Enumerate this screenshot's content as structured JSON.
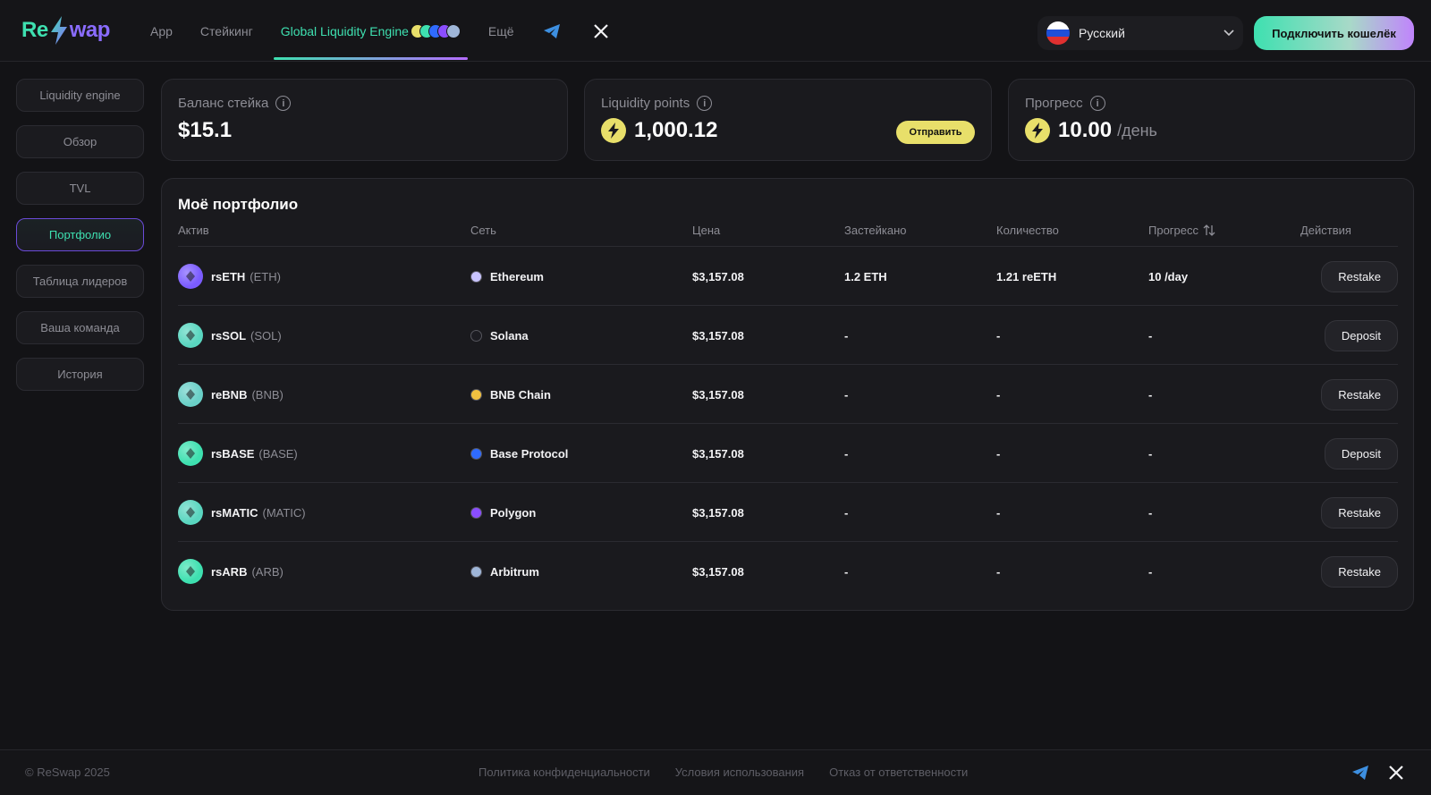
{
  "brand": {
    "part1": "Re",
    "part2": "wap"
  },
  "nav": {
    "items": [
      "App",
      "Стейкинг",
      "Global Liquidity Engine",
      "Ещё"
    ],
    "active": "Global Liquidity Engine"
  },
  "language": {
    "label": "Русский"
  },
  "connect_button": "Подключить кошелёк",
  "sidebar": {
    "items": [
      "Liquidity engine",
      "Обзор",
      "TVL",
      "Портфолио",
      "Таблица лидеров",
      "Ваша команда",
      "История"
    ],
    "active": "Портфолио"
  },
  "stats": {
    "stake_balance": {
      "label": "Баланс стейка",
      "value": "$15.1"
    },
    "liquidity_points": {
      "label": "Liquidity points",
      "value": "1,000.12",
      "button": "Отправить"
    },
    "progress": {
      "label": "Прогресс",
      "value": "10.00",
      "unit": "/день"
    }
  },
  "portfolio": {
    "title": "Моё портфолио",
    "columns": [
      "Актив",
      "Сеть",
      "Цена",
      "Застейкано",
      "Количество",
      "Прогресс",
      "Действия"
    ],
    "rows": [
      {
        "asset": "rsETH",
        "ticker": "(ETH)",
        "network": "Ethereum",
        "price": "$3,157.08",
        "staked": "1.2 ETH",
        "amount": "1.21 reETH",
        "progress": "10 /day",
        "action": "Restake",
        "color": "#7b5cff",
        "net_color": "#c9c4ff"
      },
      {
        "asset": "rsSOL",
        "ticker": "(SOL)",
        "network": "Solana",
        "price": "$3,157.08",
        "staked": "-",
        "amount": "-",
        "progress": "-",
        "action": "Deposit",
        "color": "#5ad6c0",
        "net_color": "#1c1c22"
      },
      {
        "asset": "reBNB",
        "ticker": "(BNB)",
        "network": "BNB Chain",
        "price": "$3,157.08",
        "staked": "-",
        "amount": "-",
        "progress": "-",
        "action": "Restake",
        "color": "#6ad0c8",
        "net_color": "#f0c040"
      },
      {
        "asset": "rsBASE",
        "ticker": "(BASE)",
        "network": "Base Protocol",
        "price": "$3,157.08",
        "staked": "-",
        "amount": "-",
        "progress": "-",
        "action": "Deposit",
        "color": "#3ee0b0",
        "net_color": "#2f6bff"
      },
      {
        "asset": "rsMATIC",
        "ticker": "(MATIC)",
        "network": "Polygon",
        "price": "$3,157.08",
        "staked": "-",
        "amount": "-",
        "progress": "-",
        "action": "Restake",
        "color": "#5ad6c0",
        "net_color": "#8a4dff"
      },
      {
        "asset": "rsARB",
        "ticker": "(ARB)",
        "network": "Arbitrum",
        "price": "$3,157.08",
        "staked": "-",
        "amount": "-",
        "progress": "-",
        "action": "Restake",
        "color": "#3ee0b0",
        "net_color": "#9fb6d8"
      }
    ]
  },
  "footer": {
    "copyright": "© ReSwap 2025",
    "links": [
      "Политика конфиденциальности",
      "Условия использования",
      "Отказ от ответственности"
    ]
  },
  "icons": [
    "bolt-icon",
    "telegram-icon",
    "x-icon",
    "chevron-down-icon",
    "info-icon",
    "sort-icon",
    "lightning-icon"
  ],
  "colors": {
    "accent_green": "#3ee0b0",
    "accent_purple": "#8a6cff",
    "yellow": "#e8df6a",
    "background": "#131316"
  }
}
